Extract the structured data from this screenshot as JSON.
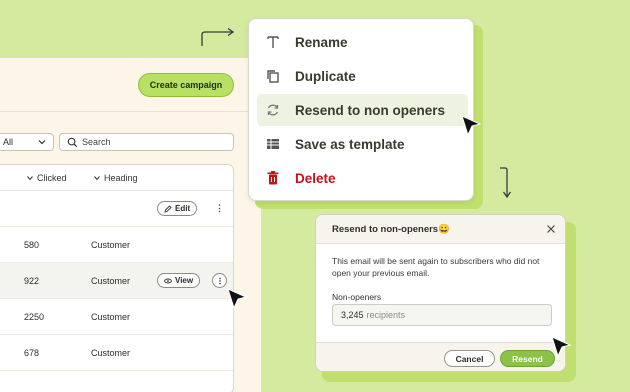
{
  "toolbar": {
    "create_campaign_label": "Create campaign",
    "filter_value": "All",
    "search_placeholder": "Search"
  },
  "table": {
    "columns": [
      "Clicked",
      "Heading"
    ],
    "header_row": {
      "edit_label": "Edit"
    },
    "rows": [
      {
        "clicked": "580",
        "heading": "Customer"
      },
      {
        "clicked": "922",
        "heading": "Customer",
        "view_label": "View"
      },
      {
        "clicked": "2250",
        "heading": "Customer"
      },
      {
        "clicked": "678",
        "heading": "Customer"
      }
    ]
  },
  "context_menu": {
    "items": [
      {
        "label": "Rename",
        "icon": "text-icon"
      },
      {
        "label": "Duplicate",
        "icon": "duplicate-icon"
      },
      {
        "label": "Resend to non openers",
        "icon": "resend-icon",
        "active": true
      },
      {
        "label": "Save as template",
        "icon": "template-icon"
      },
      {
        "label": "Delete",
        "icon": "trash-icon",
        "danger": true
      }
    ]
  },
  "dialog": {
    "title": "Resend to non-openers😀",
    "body": "This email will be sent again to subscribers who did not open your previous email.",
    "field_label": "Non-openers",
    "field_value": "3,245",
    "field_unit": "recipients",
    "cancel_label": "Cancel",
    "resend_label": "Resend"
  },
  "colors": {
    "background": "#d3ea9f",
    "accent": "#b8e064",
    "primary_button": "#8bc34a",
    "danger": "#c0141b"
  }
}
